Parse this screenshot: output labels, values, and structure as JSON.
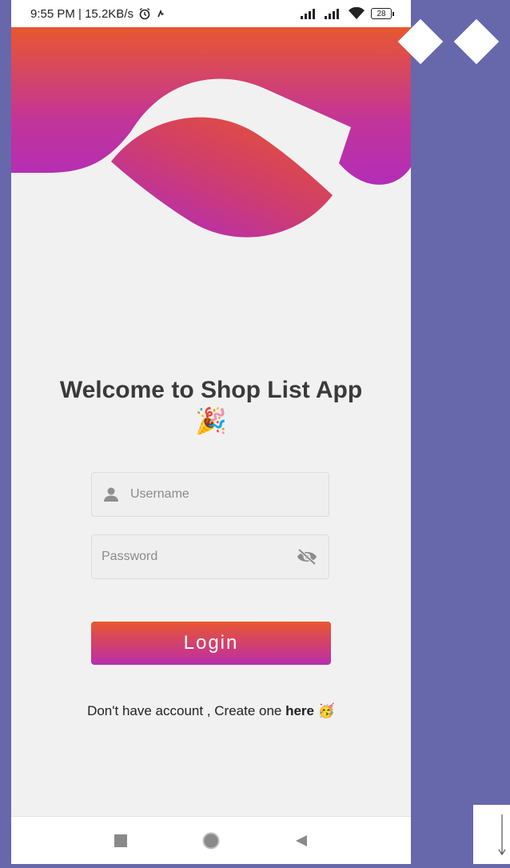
{
  "status_bar": {
    "time_speed": "9:55 PM | 15.2KB/s",
    "battery": "28"
  },
  "welcome": {
    "title": "Welcome to Shop List App",
    "emoji": "🎉"
  },
  "form": {
    "username_placeholder": "Username",
    "password_placeholder": "Password"
  },
  "login_label": "Login",
  "signup": {
    "prefix": "Don't have account , Create one ",
    "link": "here",
    "emoji": "🥳"
  },
  "icons": {
    "user": "user-icon",
    "eye_off": "eye-off-icon",
    "alarm": "alarm-icon",
    "wifi": "wifi-icon"
  },
  "colors": {
    "gradient_top": "#e8572f",
    "gradient_bottom": "#b42fb3",
    "background": "#f1f1f1",
    "outer": "#6767ac"
  }
}
